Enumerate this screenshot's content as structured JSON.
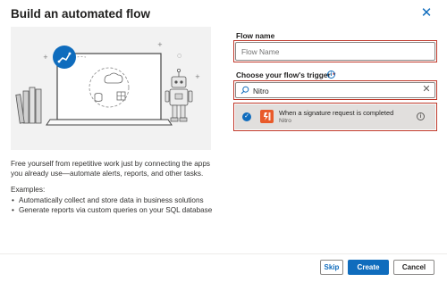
{
  "dialog": {
    "title": "Build an automated flow",
    "close_icon": "close-icon"
  },
  "left": {
    "description": "Free yourself from repetitive work just by connecting the apps you already use—automate alerts, reports, and other tasks.",
    "examples_title": "Examples:",
    "examples": [
      "Automatically collect and store data in business solutions",
      "Generate reports via custom queries on your SQL database"
    ]
  },
  "form": {
    "flow_name_label": "Flow name",
    "flow_name_placeholder": "Flow Name",
    "trigger_label": "Choose your flow's trigger",
    "required_mark": "*",
    "search_value": "Nitro",
    "trigger_result": {
      "title": "When a signature request is completed",
      "connector": "Nitro",
      "selected": true
    }
  },
  "footer": {
    "skip": "Skip",
    "create": "Create",
    "cancel": "Cancel"
  },
  "colors": {
    "accent": "#0f6cbd",
    "highlight": "#c0392b",
    "nitro": "#e95a2a"
  }
}
